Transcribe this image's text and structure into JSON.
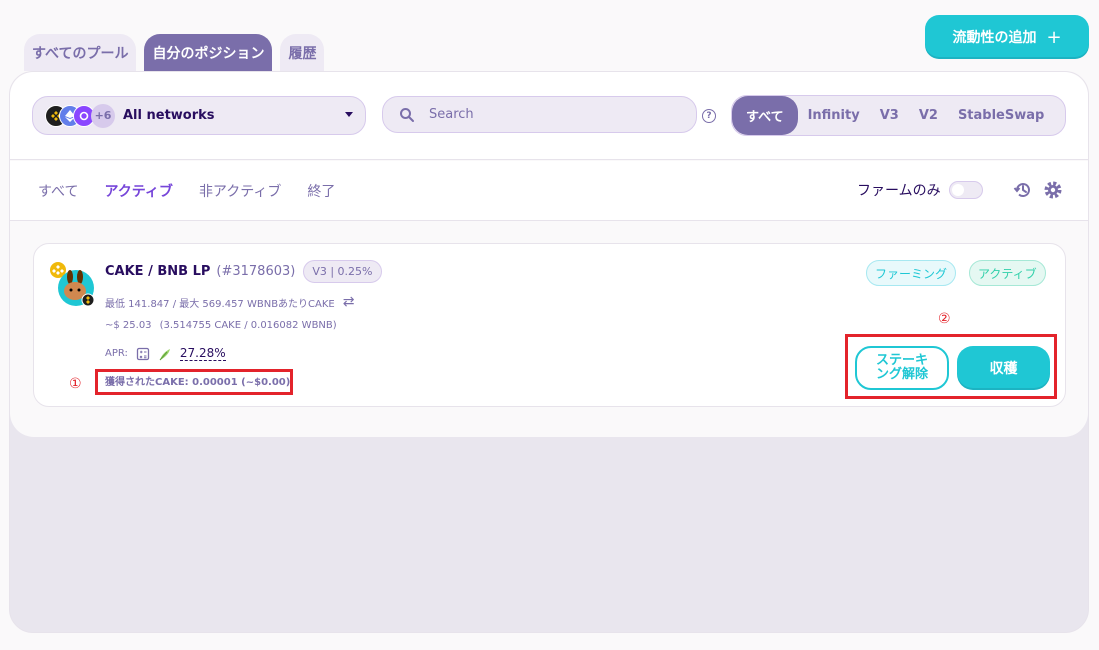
{
  "tabs": {
    "all_pools": "すべてのプール",
    "my_positions": "自分のポジション",
    "history": "履歴"
  },
  "add_liquidity": {
    "label": "流動性の追加",
    "plus": "+"
  },
  "network": {
    "label": "All networks",
    "extra_count": "+6"
  },
  "search": {
    "placeholder": "Search"
  },
  "protocol_filter": {
    "items": [
      "すべて",
      "Infinity",
      "V3",
      "V2",
      "StableSwap"
    ],
    "selected": "すべて"
  },
  "status_filter": {
    "items": [
      "すべて",
      "アクティブ",
      "非アクティブ",
      "終了"
    ],
    "selected": "アクティブ"
  },
  "farm_only": {
    "label": "ファームのみ",
    "enabled": false
  },
  "position": {
    "pair": "CAKE / BNB LP",
    "id": "(#3178603)",
    "version_badge": "V3 | 0.25%",
    "range": "最低 141.847 / 最大 569.457  WBNBあたりCAKE",
    "value_usd": "~$ 25.03",
    "value_tokens": "(3.514755 CAKE / 0.016082 WBNB)",
    "apr_label": "APR:",
    "apr_value": "27.28%",
    "earned": "獲得されたCAKE: 0.00001 (~$0.00)",
    "tags": [
      "ファーミング",
      "アクティブ"
    ],
    "unstake_label": "ステーキング解除",
    "harvest_label": "収穫"
  },
  "annotations": {
    "one": "①",
    "two": "②"
  },
  "colors": {
    "primary": "#1fc7d4",
    "secondary": "#7a6eaa",
    "text": "#280d5f",
    "annotation": "#e3232b",
    "active_status": "#7645d9"
  }
}
